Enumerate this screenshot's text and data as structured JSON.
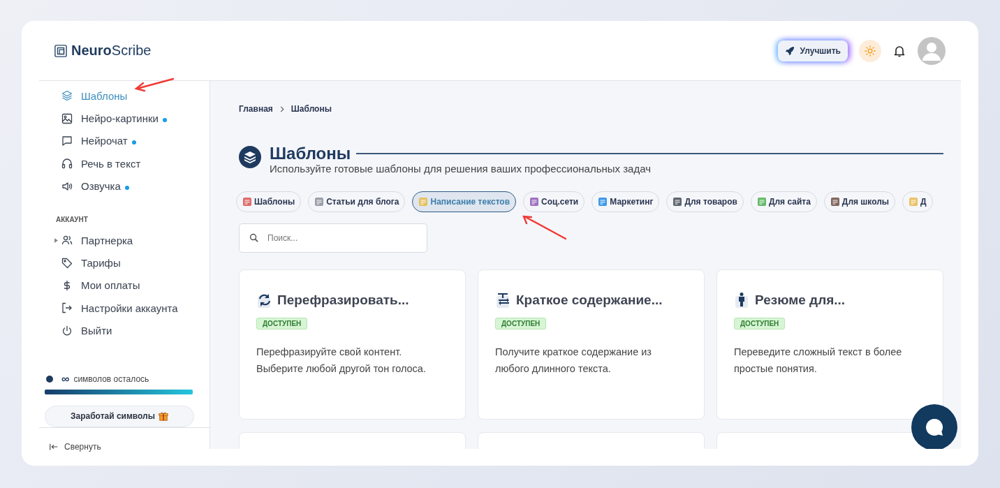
{
  "header": {
    "logo": "**Neuro**Scribe",
    "upgrade_button": "Улучшить"
  },
  "sidebar": {
    "items": [
      {
        "label": "Шаблоны",
        "selected": true,
        "dot": false
      },
      {
        "label": "Нейро-картинки",
        "selected": false,
        "dot": true
      },
      {
        "label": "Нейрочат",
        "selected": false,
        "dot": true
      },
      {
        "label": "Речь в текст",
        "selected": false,
        "dot": false
      },
      {
        "label": "Озвучка",
        "selected": false,
        "dot": true
      }
    ],
    "account_heading": "АККАУНТ",
    "account_items": [
      {
        "label": "Партнерка",
        "expanded": false
      },
      {
        "label": "Тарифы"
      },
      {
        "label": "Мои оплаты"
      },
      {
        "label": "Настройки аккаунта"
      },
      {
        "label": "Выйти"
      }
    ],
    "symbols": {
      "amount": "∞",
      "label": "символов осталось",
      "level": 1
    },
    "earn_button": "Заработай символы",
    "collapse": "Свернуть"
  },
  "breadcrumb": [
    "Главная",
    "Шаблоны"
  ],
  "page": {
    "title": "Шаблоны",
    "subtitle": "Используйте готовые шаблоны для решения ваших профессиональных задач"
  },
  "chips": [
    {
      "label": "Шаблоны",
      "selected": false
    },
    {
      "label": "Статьи для блога",
      "selected": false
    },
    {
      "label": "Написание текстов",
      "selected": true
    },
    {
      "label": "Соц.сети",
      "selected": false
    },
    {
      "label": "Маркетинг",
      "selected": false
    },
    {
      "label": "Для товаров",
      "selected": false
    },
    {
      "label": "Для сайта",
      "selected": false
    },
    {
      "label": "Для школы",
      "selected": false
    },
    {
      "label": "Д",
      "selected": false
    }
  ],
  "search": {
    "placeholder": "Поиск..."
  },
  "cards": [
    {
      "title": "Перефразировать...",
      "badge": "ДОСТУПЕН",
      "description": "Перефразируйте свой контент. Выберите любой другой тон голоса."
    },
    {
      "title": "Краткое содержание...",
      "badge": "ДОСТУПЕН",
      "description": "Получите краткое содержание из любого длинного текста."
    },
    {
      "title": "Резюме для...",
      "badge": "ДОСТУПЕН",
      "description": "Переведите сложный текст в более простые понятия."
    }
  ]
}
